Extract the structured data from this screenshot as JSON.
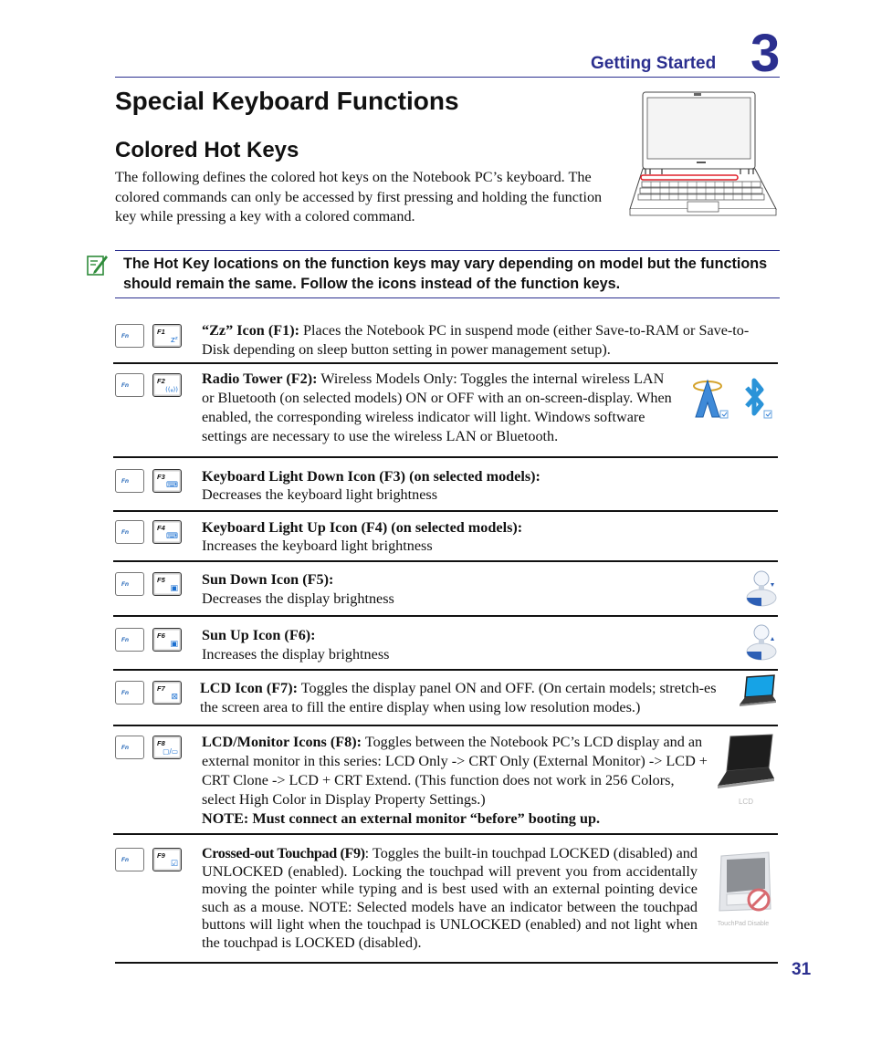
{
  "header": {
    "chapter_title": "Getting Started",
    "chapter_number": "3"
  },
  "title": "Special Keyboard Functions",
  "section": {
    "title": "Colored Hot Keys",
    "intro": "The following defines the colored hot keys on the Notebook PC’s keyboard. The colored commands can only be accessed by first pressing and holding the function key while pressing a key with a colored command."
  },
  "illustration": {
    "name": "notebook-with-function-row-highlighted",
    "highlight_color": "#e0202a"
  },
  "note": {
    "icon": "note-pencil-icon",
    "text": "The Hot Key locations on the function keys may vary depending on model but the functions should remain the same. Follow the icons instead of the function keys."
  },
  "hotkeys": [
    {
      "fn_label": "Fn",
      "key_label": "F1",
      "key_icon": "zz-sleep-icon",
      "key_glyph": "zᶻ",
      "title": "“Zz” Icon (F1):",
      "text": " Places the Notebook PC in suspend mode (either Save-to-RAM or Save-to-Disk depending on sleep button setting in power management setup)."
    },
    {
      "fn_label": "Fn",
      "key_label": "F2",
      "key_icon": "radio-tower-icon",
      "key_glyph": "((ᵩ))",
      "title": "Radio Tower (F2):",
      "text": " Wireless Models Only: Toggles the internal wireless LAN or Bluetooth (on selected models) ON or OFF with an on-screen-display. When enabled, the corresponding wireless indicator will light. Windows software settings are necessary to use the wireless LAN or Bluetooth.",
      "osd_icons": [
        "wireless-lan-osd-icon",
        "bluetooth-osd-icon"
      ]
    },
    {
      "fn_label": "Fn",
      "key_label": "F3",
      "key_icon": "keyboard-light-down-icon",
      "key_glyph": "⌨",
      "title": "Keyboard Light Down Icon (F3) (on selected models):",
      "text": "Decreases the keyboard light brightness"
    },
    {
      "fn_label": "Fn",
      "key_label": "F4",
      "key_icon": "keyboard-light-up-icon",
      "key_glyph": "⌨",
      "title": "Keyboard Light Up Icon (F4) (on selected models):",
      "text": "Increases the keyboard light brightness"
    },
    {
      "fn_label": "Fn",
      "key_label": "F5",
      "key_icon": "sun-down-icon",
      "key_glyph": "▣",
      "title": "Sun Down Icon (F5):",
      "text": "Decreases the display brightness",
      "osd_icons": [
        "brightness-down-osd-icon"
      ]
    },
    {
      "fn_label": "Fn",
      "key_label": "F6",
      "key_icon": "sun-up-icon",
      "key_glyph": "▣",
      "title": "Sun Up Icon (F6):",
      "text": "Increases the display brightness",
      "osd_icons": [
        "brightness-up-osd-icon"
      ]
    },
    {
      "fn_label": "Fn",
      "key_label": "F7",
      "key_icon": "lcd-off-icon",
      "key_glyph": "⊠",
      "title": "LCD Icon (F7):",
      "text": " Toggles the display panel ON and OFF. (On certain models; stretch-es the screen area to fill the entire display when using low resolution modes.)",
      "osd_icons": [
        "lcd-osd-icon"
      ]
    },
    {
      "fn_label": "Fn",
      "key_label": "F8",
      "key_icon": "lcd-monitor-icon",
      "key_glyph": "▢/▭",
      "title": "LCD/Monitor Icons (F8):",
      "text": " Toggles between the Notebook PC’s LCD display and an external monitor in this series: LCD Only -> CRT Only (External Monitor) -> LCD + CRT Clone -> LCD + CRT Extend. (This function does not work in 256 Colors, select High Color in Display Property Settings.)",
      "note": "NOTE: Must connect an external monitor “before” booting up.",
      "osd_icons": [
        "lcd-display-osd-icon"
      ],
      "osd_caption": "LCD"
    },
    {
      "fn_label": "Fn",
      "key_label": "F9",
      "key_icon": "crossed-out-touchpad-icon",
      "key_glyph": "☑",
      "title": "Crossed-out Touchpad (F9)",
      "text": ": Toggles the built-in touchpad LOCKED (disabled) and UNLOCKED (enabled). Locking the touchpad will prevent you from accidentally moving the pointer while typing and is best used with an external pointing device such as a mouse. NOTE: Selected models have an indicator between the touchpad buttons will light when the touchpad is UNLOCKED (enabled) and not light when the touchpad is LOCKED (disabled).",
      "osd_icons": [
        "touchpad-disable-osd-icon"
      ],
      "osd_caption": "TouchPad Disable"
    }
  ],
  "footer": {
    "page_number": "31"
  },
  "colors": {
    "accent": "#2b2f8f",
    "note_icon": "#2e8b3a",
    "key_glyph": "#1a6fd0"
  }
}
